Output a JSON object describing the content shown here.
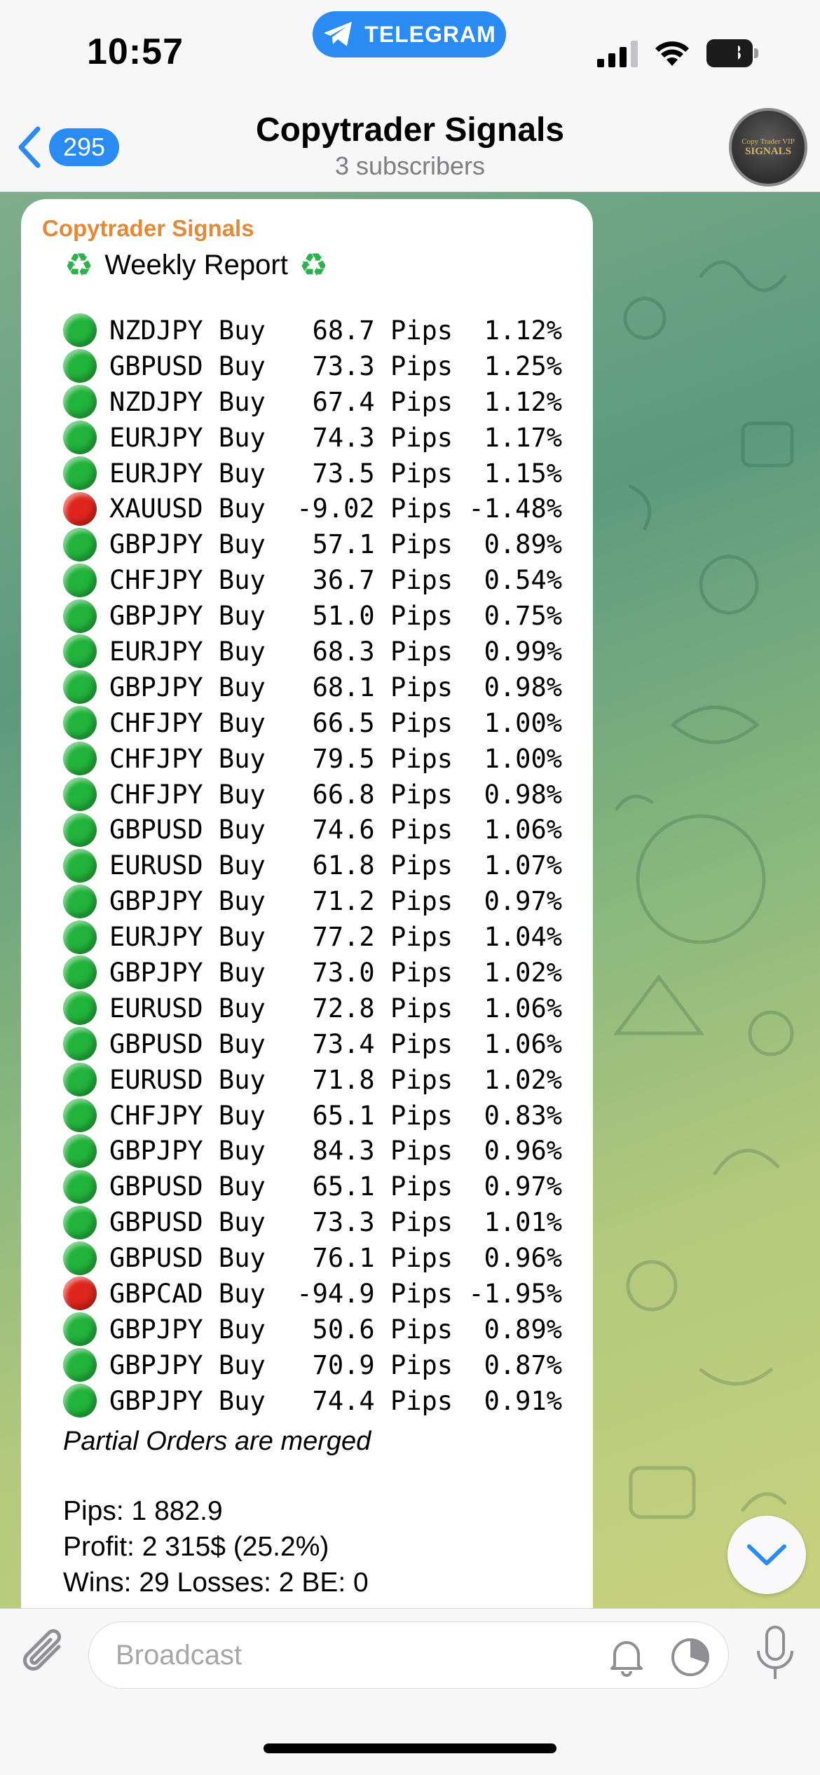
{
  "status_bar": {
    "time": "10:57",
    "app_pill": "TELEGRAM",
    "battery": "68",
    "battery_level": 0.68
  },
  "header": {
    "back_count": "295",
    "title": "Copytrader Signals",
    "subtitle": "3 subscribers",
    "avatar_line1": "Copy Trader VIP",
    "avatar_line2": "SIGNALS"
  },
  "message": {
    "sender": "Copytrader Signals",
    "report_title": "Weekly Report",
    "report_icon": "♻",
    "rows": [
      {
        "status": "green",
        "text": "NZDJPY Buy   68.7 Pips  1.12%"
      },
      {
        "status": "green",
        "text": "GBPUSD Buy   73.3 Pips  1.25%"
      },
      {
        "status": "green",
        "text": "NZDJPY Buy   67.4 Pips  1.12%"
      },
      {
        "status": "green",
        "text": "EURJPY Buy   74.3 Pips  1.17%"
      },
      {
        "status": "green",
        "text": "EURJPY Buy   73.5 Pips  1.15%"
      },
      {
        "status": "red",
        "text": "XAUUSD Buy  -9.02 Pips -1.48%"
      },
      {
        "status": "green",
        "text": "GBPJPY Buy   57.1 Pips  0.89%"
      },
      {
        "status": "green",
        "text": "CHFJPY Buy   36.7 Pips  0.54%"
      },
      {
        "status": "green",
        "text": "GBPJPY Buy   51.0 Pips  0.75%"
      },
      {
        "status": "green",
        "text": "EURJPY Buy   68.3 Pips  0.99%"
      },
      {
        "status": "green",
        "text": "GBPJPY Buy   68.1 Pips  0.98%"
      },
      {
        "status": "green",
        "text": "CHFJPY Buy   66.5 Pips  1.00%"
      },
      {
        "status": "green",
        "text": "CHFJPY Buy   79.5 Pips  1.00%"
      },
      {
        "status": "green",
        "text": "CHFJPY Buy   66.8 Pips  0.98%"
      },
      {
        "status": "green",
        "text": "GBPUSD Buy   74.6 Pips  1.06%"
      },
      {
        "status": "green",
        "text": "EURUSD Buy   61.8 Pips  1.07%"
      },
      {
        "status": "green",
        "text": "GBPJPY Buy   71.2 Pips  0.97%"
      },
      {
        "status": "green",
        "text": "EURJPY Buy   77.2 Pips  1.04%"
      },
      {
        "status": "green",
        "text": "GBPJPY Buy   73.0 Pips  1.02%"
      },
      {
        "status": "green",
        "text": "EURUSD Buy   72.8 Pips  1.06%"
      },
      {
        "status": "green",
        "text": "GBPUSD Buy   73.4 Pips  1.06%"
      },
      {
        "status": "green",
        "text": "EURUSD Buy   71.8 Pips  1.02%"
      },
      {
        "status": "green",
        "text": "CHFJPY Buy   65.1 Pips  0.83%"
      },
      {
        "status": "green",
        "text": "GBPJPY Buy   84.3 Pips  0.96%"
      },
      {
        "status": "green",
        "text": "GBPUSD Buy   65.1 Pips  0.97%"
      },
      {
        "status": "green",
        "text": "GBPUSD Buy   73.3 Pips  1.01%"
      },
      {
        "status": "green",
        "text": "GBPUSD Buy   76.1 Pips  0.96%"
      },
      {
        "status": "red",
        "text": "GBPCAD Buy  -94.9 Pips -1.95%"
      },
      {
        "status": "green",
        "text": "GBPJPY Buy   50.6 Pips  0.89%"
      },
      {
        "status": "green",
        "text": "GBPJPY Buy   70.9 Pips  0.87%"
      },
      {
        "status": "green",
        "text": "GBPJPY Buy   74.4 Pips  0.91%"
      }
    ],
    "note": "Partial Orders are merged",
    "summary": {
      "pips": "Pips: 1 882.9",
      "profit": "Profit: 2 315$ (25.2%)",
      "stats": "Wins: 29   Losses: 2   BE: 0"
    }
  },
  "input": {
    "placeholder": "Broadcast"
  },
  "icons": {
    "back": "chevron-left-icon",
    "attach": "paperclip-icon",
    "bell": "bell-icon",
    "timer": "timer-icon",
    "mic": "microphone-icon",
    "scroll": "chevron-down-icon"
  },
  "colors": {
    "accent": "#2a8bf2",
    "sender": "#e38a3a",
    "win": "#22b33c",
    "loss": "#e0261c"
  }
}
